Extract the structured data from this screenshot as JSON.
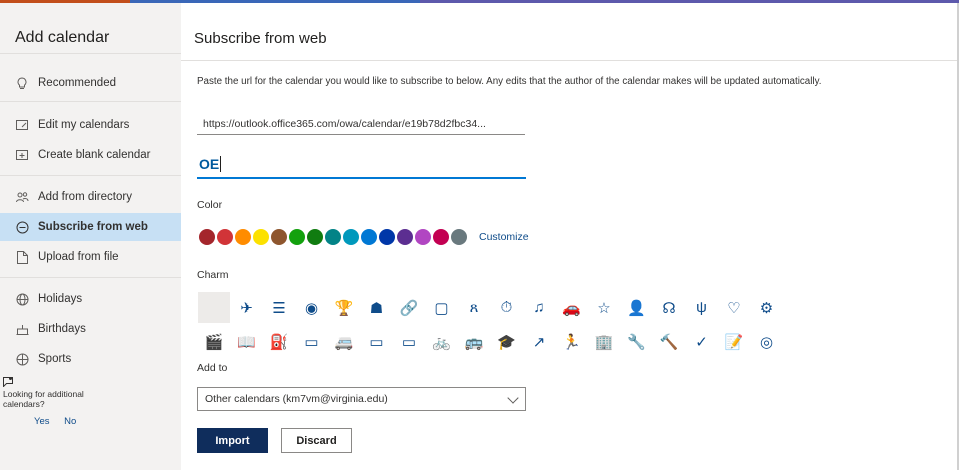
{
  "sidebar": {
    "title": "Add calendar",
    "items": [
      {
        "label": "Recommended",
        "icon": "lightbulb-icon"
      },
      {
        "label": "Edit my calendars",
        "icon": "edit-calendar-icon"
      },
      {
        "label": "Create blank calendar",
        "icon": "blank-calendar-icon"
      },
      {
        "label": "Add from directory",
        "icon": "people-icon"
      },
      {
        "label": "Subscribe from web",
        "icon": "globe-link-icon",
        "active": true
      },
      {
        "label": "Upload from file",
        "icon": "file-upload-icon"
      },
      {
        "label": "Holidays",
        "icon": "globe-icon"
      },
      {
        "label": "Birthdays",
        "icon": "cake-icon"
      },
      {
        "label": "Sports",
        "icon": "sports-icon"
      }
    ],
    "more_prompt": "Looking for additional calendars?",
    "yes_label": "Yes",
    "no_label": "No"
  },
  "main": {
    "title": "Subscribe from web",
    "description": "Paste the url for the calendar you would like to subscribe to below. Any edits that the author of the calendar makes will be updated automatically.",
    "url_value": "https://outlook.office365.com/owa/calendar/e19b78d2fbc34...",
    "name_value": "OE",
    "color_label": "Color",
    "colors": [
      "#a4262c",
      "#d13438",
      "#ff8c00",
      "#fce100",
      "#8e562e",
      "#13a10e",
      "#107c10",
      "#038387",
      "#0099bc",
      "#0078d4",
      "#0037a8",
      "#5c2e91",
      "#b146c2",
      "#c30052",
      "#69797e"
    ],
    "customize_label": "Customize",
    "charm_label": "Charm",
    "charms_row1": [
      "",
      "✈",
      "☰",
      "◉",
      "🏆",
      "☗",
      "🔗",
      "▢",
      "ጸ",
      "⏱",
      "♫",
      "🚗",
      "☆",
      "👤",
      "☊",
      "ψ",
      "♡",
      "⚙"
    ],
    "charms_row2": [
      "🎬",
      "📖",
      "⛽",
      "▭",
      "🚐",
      "▭",
      "▭",
      "🚲",
      "🚌",
      "🎓",
      "↗",
      "🏃",
      "🏢",
      "🔧",
      "🔨",
      "✓",
      "📝",
      "◎"
    ],
    "add_to_label": "Add to",
    "add_to_value": "Other calendars (km7vm@virginia.edu)",
    "import_label": "Import",
    "discard_label": "Discard"
  }
}
